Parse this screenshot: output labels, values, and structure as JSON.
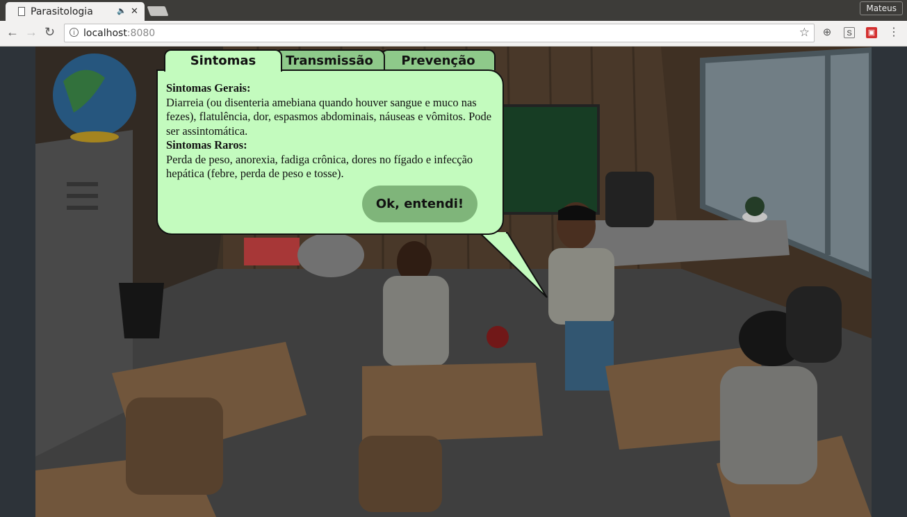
{
  "browser": {
    "tab_title": "Parasitologia",
    "audio_icon": "🔈",
    "close_glyph": "✕",
    "profile_name": "Mateus",
    "url_host": "localhost",
    "url_port": ":8080"
  },
  "dialog": {
    "tabs": [
      {
        "label": "Sintomas",
        "active": true
      },
      {
        "label": "Transmissão",
        "active": false
      },
      {
        "label": "Prevenção",
        "active": false
      }
    ],
    "sections": [
      {
        "heading": "Sintomas Gerais:",
        "body": "Diarreia (ou disenteria amebiana quando houver sangue e muco nas fezes), flatulência, dor, espasmos abdominais, náuseas e vômitos. Pode ser assintomática."
      },
      {
        "heading": "Sintomas Raros:",
        "body": "Perda de peso, anorexia, fadiga crônica, dores no fígado e infecção hepática (febre, perda de peso e tosse)."
      }
    ],
    "ok_label": "Ok, entendi!"
  },
  "colors": {
    "bubble": "#c3fbbe",
    "tab_active": "#c3fbbe",
    "tab_inactive": "#8ec98a",
    "button": "#7fb57a"
  }
}
